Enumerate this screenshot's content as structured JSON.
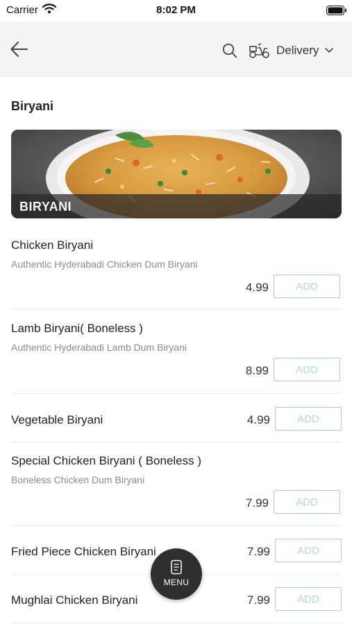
{
  "status_bar": {
    "carrier": "Carrier",
    "time": "8:02 PM"
  },
  "header": {
    "delivery_label": "Delivery"
  },
  "section": {
    "title": "Biryani",
    "banner_label": "BIRYANI"
  },
  "menu_items": [
    {
      "name": "Chicken Biryani",
      "description": "Authentic Hyderabadi Chicken Dum Biryani",
      "price": "4.99",
      "add_label": "ADD"
    },
    {
      "name": "Lamb Biryani( Boneless )",
      "description": "Authentic Hyderabadi Lamb Dum Biryani",
      "price": "8.99",
      "add_label": "ADD"
    },
    {
      "name": "Vegetable Biryani",
      "description": "",
      "price": "4.99",
      "add_label": "ADD"
    },
    {
      "name": "Special Chicken Biryani ( Boneless )",
      "description": "Boneless Chicken Dum Biryani",
      "price": "7.99",
      "add_label": "ADD"
    },
    {
      "name": "Fried Piece Chicken Biryani",
      "description": "",
      "price": "7.99",
      "add_label": "ADD"
    },
    {
      "name": "Mughlai Chicken Biryani",
      "description": "",
      "price": "7.99",
      "add_label": "ADD"
    }
  ],
  "fab": {
    "label": "MENU"
  },
  "colors": {
    "header_bg": "#f4f4f4",
    "add_border": "#a8d4b4",
    "add_text": "#b4dcc0",
    "fab_bg": "#2f2f2f"
  },
  "icons": [
    "back-arrow-icon",
    "search-icon",
    "scooter-icon",
    "chevron-down-icon",
    "menu-card-icon",
    "wifi-icon",
    "battery-icon"
  ]
}
